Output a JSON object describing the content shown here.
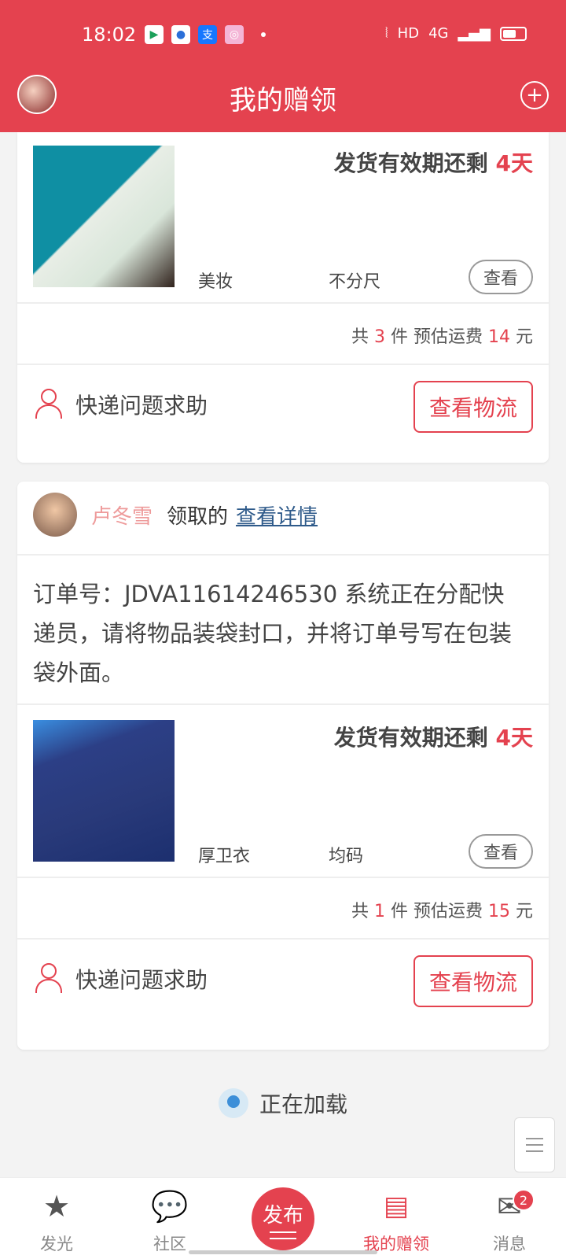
{
  "statusbar": {
    "time": "18:02",
    "network": "HD",
    "signal": "4G"
  },
  "header": {
    "title": "我的赠领",
    "add_icon": "plus-circle-icon"
  },
  "cards": [
    {
      "validity_prefix": "发货有效期还剩 ",
      "validity_days": "4天",
      "item_name": "美妆",
      "item_size": "不分尺",
      "view_label": "查看",
      "summary_prefix": "共 ",
      "count": "3",
      "summary_mid": " 件 预估运费 ",
      "fee": "14",
      "summary_suffix": " 元",
      "help_label": "快递问题求助",
      "logistics_label": "查看物流"
    },
    {
      "claimer_name": "卢冬雪",
      "claimer_action": "领取的",
      "details_link": "查看详情",
      "order_text": "订单号：JDVA11614246530 系统正在分配快递员，请将物品装袋封口，并将订单号写在包装袋外面。",
      "validity_prefix": "发货有效期还剩 ",
      "validity_days": "4天",
      "item_name": "厚卫衣",
      "item_size": "均码",
      "view_label": "查看",
      "summary_prefix": "共 ",
      "count": "1",
      "summary_mid": " 件 预估运费 ",
      "fee": "15",
      "summary_suffix": " 元",
      "help_label": "快递问题求助",
      "logistics_label": "查看物流"
    }
  ],
  "loading": {
    "label": "正在加载"
  },
  "nav": {
    "items": [
      {
        "label": "发光",
        "icon": "star-icon"
      },
      {
        "label": "社区",
        "icon": "chat-icon"
      },
      {
        "label": "发布",
        "icon": "publish-icon"
      },
      {
        "label": "我的赠领",
        "icon": "gift-box-icon"
      },
      {
        "label": "消息",
        "icon": "mail-icon"
      }
    ],
    "badge": "2"
  },
  "colors": {
    "accent": "#e4424f"
  }
}
